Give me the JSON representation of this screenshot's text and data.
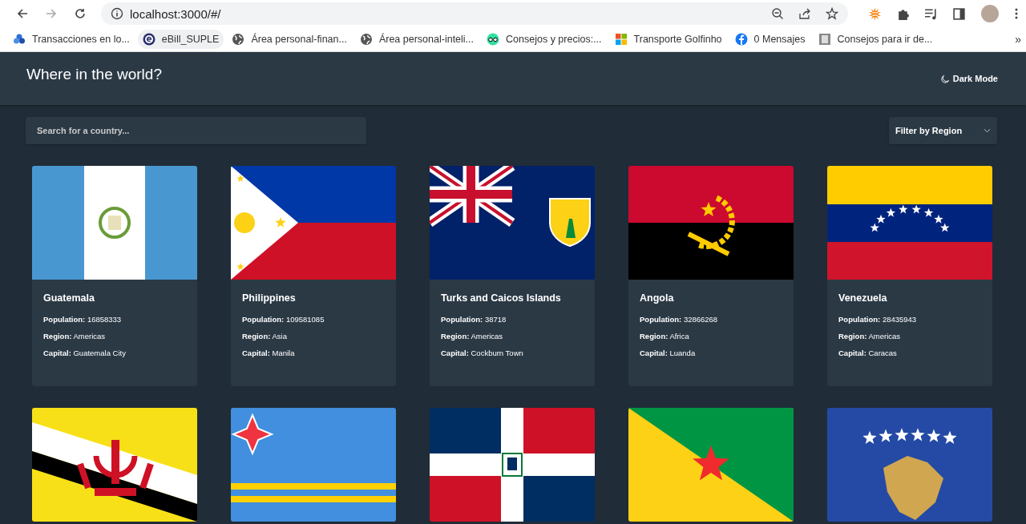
{
  "browser": {
    "address": "localhost:3000/#/",
    "bookmarks": [
      {
        "title": "Transacciones en lo...",
        "highlighted": false
      },
      {
        "title": "eBill_SUPLE",
        "highlighted": true
      },
      {
        "title": "Área personal-finan...",
        "highlighted": false
      },
      {
        "title": "Área personal-inteli...",
        "highlighted": false
      },
      {
        "title": "Consejos y precios:...",
        "highlighted": false
      },
      {
        "title": "Transporte Golfinho",
        "highlighted": false
      },
      {
        "title": "0 Mensajes",
        "highlighted": false
      },
      {
        "title": "Consejos para ir de...",
        "highlighted": false
      }
    ],
    "more_bookmarks": "»"
  },
  "header": {
    "title": "Where in the world?",
    "theme_toggle": "Dark Mode"
  },
  "search": {
    "placeholder": "Search for a country..."
  },
  "filter": {
    "label": "Filter by Region"
  },
  "countries": [
    {
      "kind": "details",
      "name": "Guatemala",
      "population_label": "Population:",
      "population": "16858333",
      "region_label": "Region:",
      "region": "Americas",
      "capital_label": "Capital:",
      "capital": "Guatemala City"
    },
    {
      "kind": "details",
      "name": "Philippines",
      "population_label": "Population:",
      "population": "109581085",
      "region_label": "Region:",
      "region": "Asia",
      "capital_label": "Capital:",
      "capital": "Manila"
    },
    {
      "kind": "details",
      "name": "Turks and Caicos Islands",
      "population_label": "Population:",
      "population": "38718",
      "region_label": "Region:",
      "region": "Americas",
      "capital_label": "Capital:",
      "capital": "Cockburn Town"
    },
    {
      "kind": "details",
      "name": "Angola",
      "population_label": "Population:",
      "population": "32866268",
      "region_label": "Region:",
      "region": "Africa",
      "capital_label": "Capital:",
      "capital": "Luanda"
    },
    {
      "kind": "details",
      "name": "Venezuela",
      "population_label": "Population:",
      "population": "28435943",
      "region_label": "Region:",
      "region": "Americas",
      "capital_label": "Capital:",
      "capital": "Caracas"
    },
    {
      "kind": "flag_only"
    },
    {
      "kind": "flag_only"
    },
    {
      "kind": "flag_only"
    },
    {
      "kind": "flag_only"
    },
    {
      "kind": "flag_only"
    }
  ]
}
